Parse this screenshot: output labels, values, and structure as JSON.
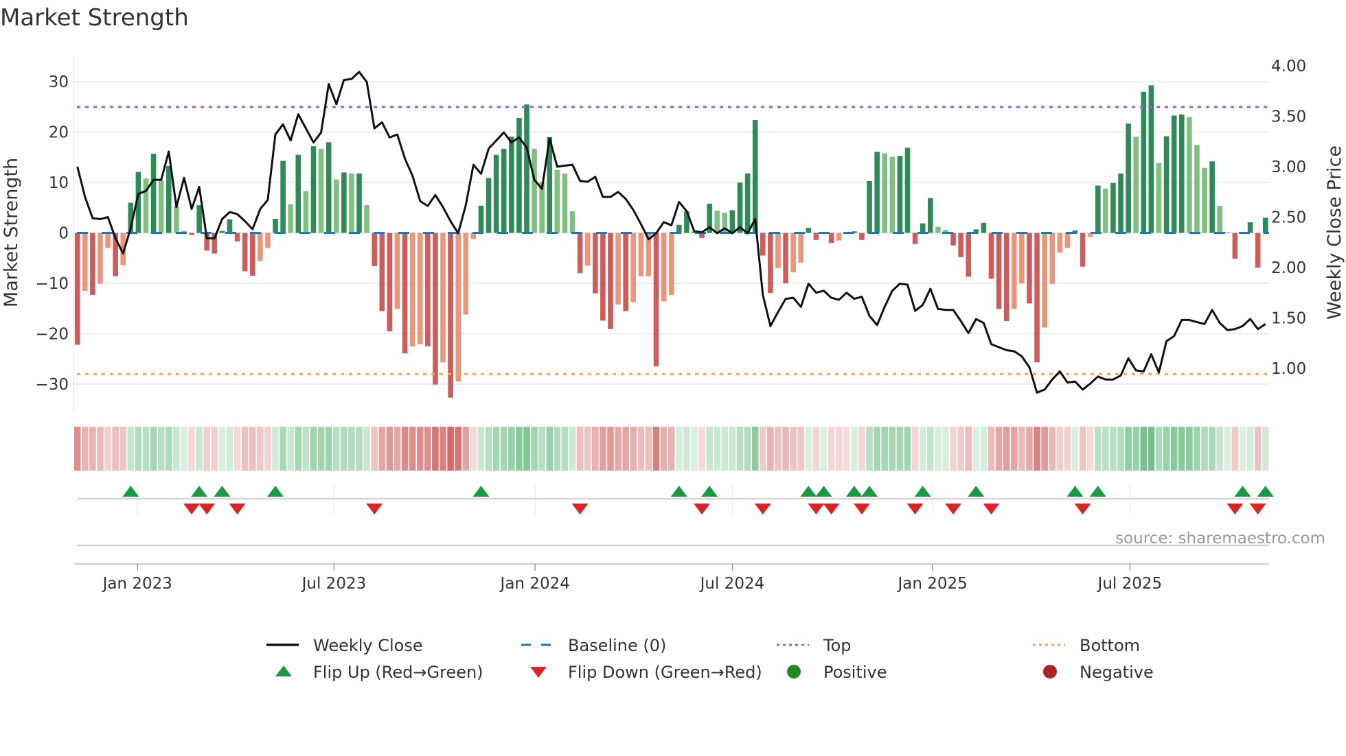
{
  "title": "Market Strength",
  "source": "source: sharemaestro.com",
  "colors": {
    "dark_green": "#2e8b57",
    "light_green": "#7fbf7f",
    "dark_red": "#cd5c5c",
    "light_red": "#e9967a",
    "weekly_close": "#111111",
    "baseline": "#1f77b4",
    "top": "#9b5de5",
    "bottom": "#f4a460",
    "flip_up": "#1a9a45",
    "flip_down": "#d62728",
    "positive": "#228b22",
    "negative": "#b22222",
    "strip_green": "#4caf6a",
    "strip_red": "#c8504d"
  },
  "chart_data": {
    "type": "bar",
    "title": "Market Strength",
    "ylabel": "Market Strength",
    "y2label": "Weekly Close Price",
    "ylim": [
      -35.2,
      35.2
    ],
    "y2lim": [
      0.585,
      4.102
    ],
    "xlim": [
      0,
      156
    ],
    "yticks": [
      {
        "v": 30,
        "label": "30"
      },
      {
        "v": 20,
        "label": "20"
      },
      {
        "v": 10,
        "label": "10"
      },
      {
        "v": 0,
        "label": "0"
      },
      {
        "v": -10,
        "label": "−10"
      },
      {
        "v": -20,
        "label": "−20"
      },
      {
        "v": -30,
        "label": "−30"
      }
    ],
    "y2ticks": [
      {
        "v": 4.0,
        "label": "4.00"
      },
      {
        "v": 3.5,
        "label": "3.50"
      },
      {
        "v": 3.0,
        "label": "3.00"
      },
      {
        "v": 2.5,
        "label": "2.50"
      },
      {
        "v": 2.0,
        "label": "2.00"
      },
      {
        "v": 1.5,
        "label": "1.50"
      },
      {
        "v": 1.0,
        "label": "1.00"
      }
    ],
    "xticks": [
      {
        "x": 7.9,
        "label": "Jan 2023"
      },
      {
        "x": 33.7,
        "label": "Jul 2023"
      },
      {
        "x": 60.1,
        "label": "Jan 2024"
      },
      {
        "x": 86.0,
        "label": "Jul 2024"
      },
      {
        "x": 112.3,
        "label": "Jan 2025"
      },
      {
        "x": 138.2,
        "label": "Jul 2025"
      }
    ],
    "top_level": 25,
    "bottom_level": -28,
    "baseline": 0,
    "strength": [
      -22.2,
      -11.5,
      -12.3,
      -10.1,
      -3.0,
      -8.6,
      -6.4,
      6.0,
      12.1,
      10.8,
      15.7,
      10.5,
      13.3,
      5.3,
      0.4,
      -0.4,
      5.5,
      -3.5,
      -4.1,
      0.4,
      2.7,
      -1.7,
      -7.6,
      -8.5,
      -5.6,
      -3.0,
      2.8,
      14.3,
      5.7,
      15.5,
      8.3,
      17.2,
      16.7,
      18.0,
      10.6,
      12.0,
      11.8,
      11.8,
      5.5,
      -6.6,
      -15.5,
      -19.5,
      -15.1,
      -23.9,
      -22.5,
      -22.1,
      -22.5,
      -30.1,
      -25.7,
      -32.7,
      -29.5,
      -16.2,
      -1.2,
      5.4,
      10.9,
      15.5,
      16.7,
      19.1,
      22.8,
      25.5,
      16.7,
      10.1,
      19.0,
      12.5,
      11.8,
      4.3,
      -8.0,
      -6.5,
      -12.0,
      -17.4,
      -19.1,
      -14.2,
      -15.5,
      -13.7,
      -8.6,
      -8.6,
      -26.5,
      -13.6,
      -12.3,
      1.6,
      4.3,
      0.3,
      -1.0,
      5.8,
      4.4,
      4.0,
      4.5,
      10.0,
      11.8,
      22.4,
      -4.5,
      -11.9,
      -7.0,
      -10.0,
      -7.8,
      -5.9,
      1.0,
      -1.4,
      0.2,
      -2.0,
      -1.5,
      -0.1,
      0.3,
      -1.4,
      10.3,
      16.1,
      15.8,
      15.1,
      15.3,
      16.9,
      -2.2,
      1.9,
      6.9,
      1.2,
      0.6,
      -2.5,
      -4.8,
      -8.7,
      0.7,
      2.0,
      -9.1,
      -15.1,
      -17.5,
      -15.1,
      -10.0,
      -14.0,
      -25.7,
      -18.8,
      -10.1,
      -3.9,
      -3.0,
      0.5,
      -6.7,
      -0.8,
      9.4,
      8.8,
      9.9,
      11.8,
      21.7,
      19.1,
      28.0,
      29.3,
      13.9,
      19.2,
      23.3,
      23.5,
      23.0,
      17.5,
      12.9,
      14.2,
      5.4,
      0.1,
      -5.1,
      0.2,
      2.1,
      -6.9,
      3.0
    ],
    "strengthening": [
      1,
      0,
      1,
      0,
      0,
      1,
      0,
      1,
      1,
      0,
      1,
      0,
      1,
      0,
      0,
      1,
      1,
      1,
      1,
      1,
      1,
      1,
      1,
      1,
      0,
      0,
      1,
      1,
      0,
      1,
      0,
      1,
      0,
      1,
      0,
      1,
      0,
      1,
      0,
      1,
      1,
      1,
      0,
      1,
      0,
      0,
      1,
      1,
      0,
      1,
      0,
      0,
      0,
      1,
      1,
      1,
      1,
      1,
      1,
      1,
      0,
      0,
      1,
      0,
      0,
      0,
      1,
      0,
      1,
      1,
      1,
      0,
      1,
      0,
      0,
      0,
      1,
      0,
      0,
      1,
      1,
      1,
      1,
      1,
      0,
      0,
      1,
      1,
      1,
      1,
      1,
      1,
      0,
      1,
      0,
      0,
      1,
      1,
      1,
      1,
      0,
      1,
      1,
      1,
      1,
      1,
      0,
      0,
      1,
      1,
      1,
      1,
      1,
      0,
      0,
      1,
      1,
      1,
      1,
      1,
      1,
      1,
      1,
      0,
      0,
      1,
      1,
      0,
      0,
      0,
      0,
      1,
      1,
      0,
      1,
      0,
      1,
      1,
      1,
      0,
      1,
      1,
      0,
      1,
      1,
      1,
      0,
      0,
      0,
      1,
      0,
      1,
      1,
      1,
      1,
      1,
      1
    ],
    "weekly_close": [
      3.0,
      2.7,
      2.49,
      2.48,
      2.5,
      2.29,
      2.14,
      2.39,
      2.73,
      2.76,
      2.87,
      2.87,
      3.15,
      2.6,
      2.89,
      2.58,
      2.8,
      2.29,
      2.29,
      2.48,
      2.55,
      2.53,
      2.46,
      2.38,
      2.58,
      2.67,
      3.32,
      3.42,
      3.26,
      3.52,
      3.38,
      3.24,
      3.34,
      3.82,
      3.62,
      3.86,
      3.87,
      3.94,
      3.84,
      3.38,
      3.44,
      3.29,
      3.32,
      3.08,
      2.91,
      2.66,
      2.61,
      2.72,
      2.6,
      2.46,
      2.34,
      2.62,
      3.02,
      2.93,
      3.18,
      3.26,
      3.34,
      3.24,
      3.29,
      3.19,
      2.87,
      2.78,
      3.28,
      3.0,
      3.01,
      3.02,
      2.86,
      2.85,
      2.9,
      2.7,
      2.7,
      2.75,
      2.68,
      2.57,
      2.43,
      2.28,
      2.34,
      2.45,
      2.42,
      2.65,
      2.56,
      2.36,
      2.35,
      2.4,
      2.34,
      2.39,
      2.34,
      2.4,
      2.34,
      2.48,
      1.73,
      1.42,
      1.56,
      1.69,
      1.7,
      1.61,
      1.84,
      1.75,
      1.77,
      1.7,
      1.68,
      1.75,
      1.69,
      1.71,
      1.52,
      1.43,
      1.61,
      1.77,
      1.84,
      1.83,
      1.57,
      1.63,
      1.79,
      1.59,
      1.58,
      1.58,
      1.47,
      1.35,
      1.49,
      1.45,
      1.24,
      1.21,
      1.18,
      1.17,
      1.12,
      1.01,
      0.76,
      0.79,
      0.89,
      0.97,
      0.86,
      0.87,
      0.79,
      0.85,
      0.92,
      0.89,
      0.89,
      0.93,
      1.1,
      0.98,
      0.97,
      1.14,
      0.96,
      1.27,
      1.32,
      1.48,
      1.48,
      1.46,
      1.44,
      1.58,
      1.45,
      1.38,
      1.39,
      1.42,
      1.49,
      1.39,
      1.44
    ],
    "flip_up": [
      7,
      16,
      19,
      26,
      53,
      79,
      83,
      96,
      98,
      102,
      104,
      111,
      118,
      131,
      134,
      153,
      156
    ],
    "flip_down": [
      15,
      17,
      21,
      39,
      66,
      82,
      90,
      97,
      99,
      103,
      110,
      115,
      120,
      132,
      152,
      155
    ],
    "legend": {
      "placement": "bottom",
      "items": [
        {
          "key": "weekly_close",
          "label": "Weekly Close",
          "symbol": "line"
        },
        {
          "key": "baseline",
          "label": "Baseline (0)",
          "symbol": "dash"
        },
        {
          "key": "top",
          "label": "Top",
          "symbol": "dot"
        },
        {
          "key": "bottom",
          "label": "Bottom",
          "symbol": "dot"
        },
        {
          "key": "flip_up",
          "label": "Flip Up (Red→Green)",
          "symbol": "tri-up"
        },
        {
          "key": "flip_down",
          "label": "Flip Down (Green→Red)",
          "symbol": "tri-down"
        },
        {
          "key": "positive",
          "label": "Positive",
          "symbol": "circle"
        },
        {
          "key": "negative",
          "label": "Negative",
          "symbol": "circle"
        }
      ]
    }
  }
}
